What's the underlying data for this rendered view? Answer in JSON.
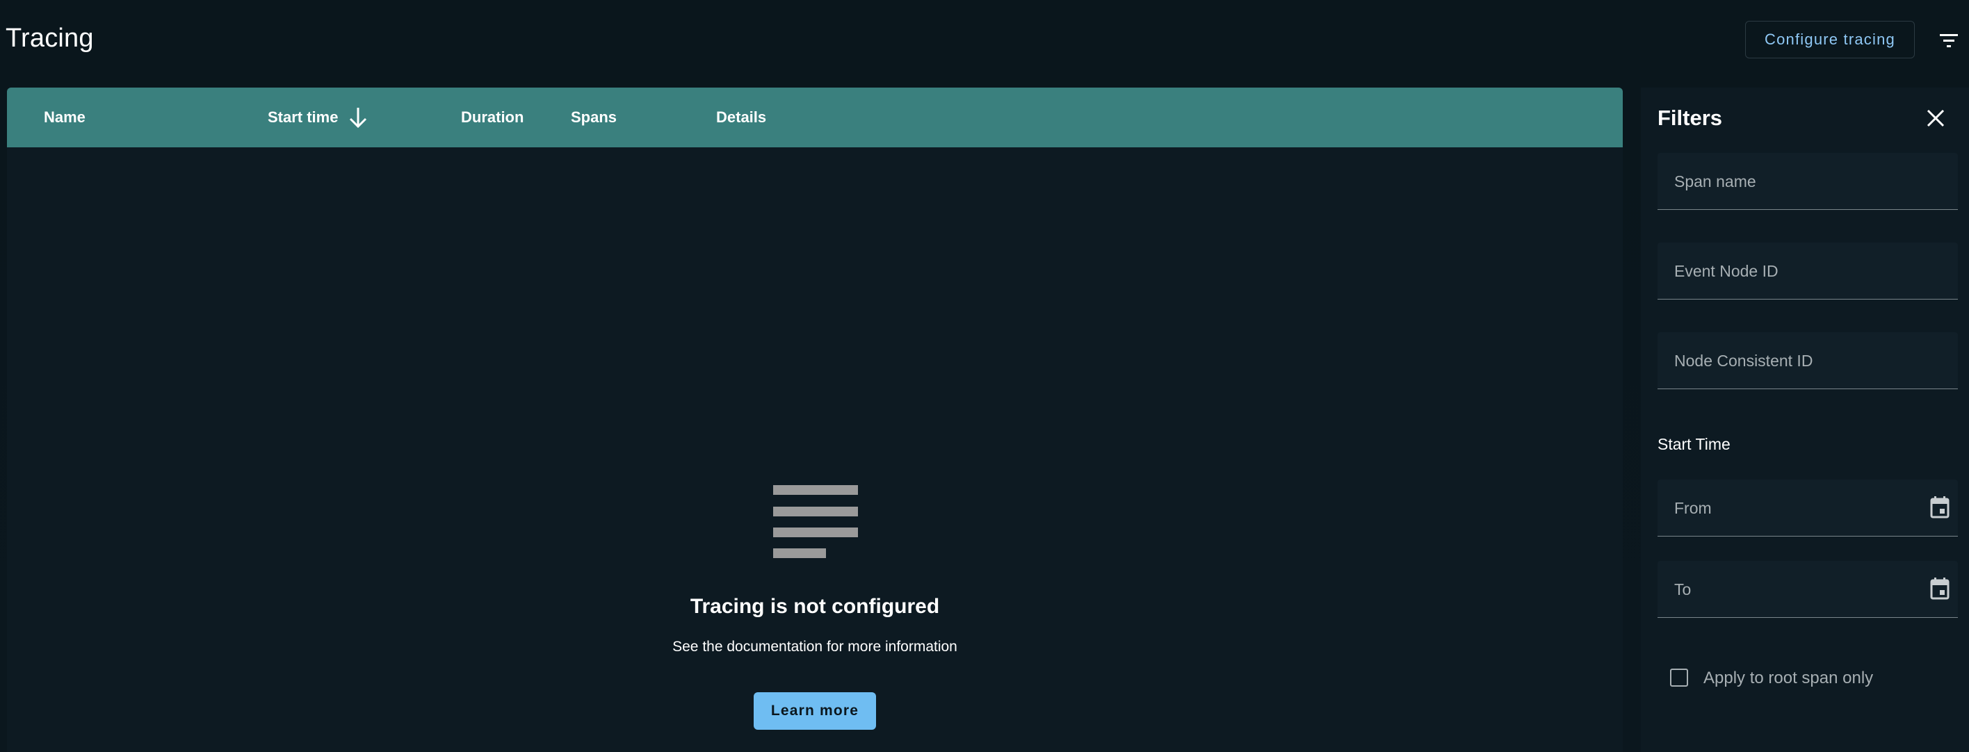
{
  "header": {
    "title": "Tracing",
    "configure_label": "Configure tracing"
  },
  "table": {
    "columns": [
      "Name",
      "Start time",
      "Duration",
      "Spans",
      "Details"
    ],
    "sort_column": "Start time",
    "sort_direction": "descending"
  },
  "empty_state": {
    "icon": "list-lines-icon",
    "title": "Tracing is not configured",
    "subtitle": "See the documentation for more information",
    "action_label": "Learn more"
  },
  "filters": {
    "title": "Filters",
    "fields": {
      "span_name": "Span name",
      "event_node_id": "Event Node ID",
      "node_consistent_id": "Node Consistent ID"
    },
    "start_time": {
      "label": "Start Time",
      "from": "From",
      "to": "To"
    },
    "root_only_label": "Apply to root span only",
    "root_only_checked": false
  },
  "colors": {
    "background": "#0b171e",
    "panel": "#0d1a22",
    "table_header": "#3a807e",
    "primary": "#6fbdf2",
    "muted_text": "#a7afb3"
  }
}
